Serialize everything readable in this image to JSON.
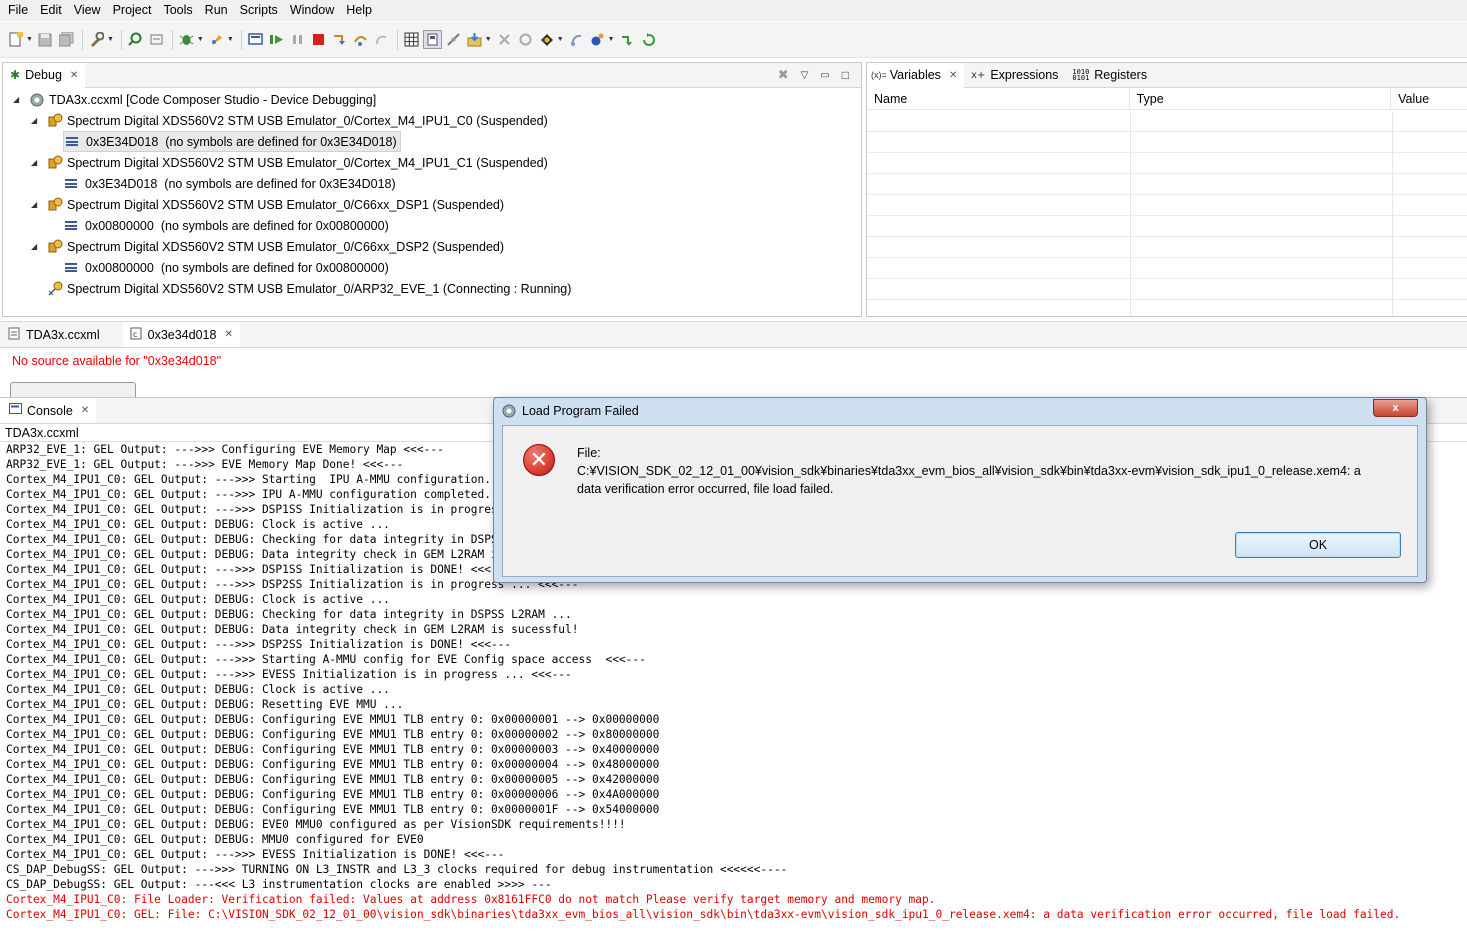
{
  "menu": [
    "File",
    "Edit",
    "View",
    "Project",
    "Tools",
    "Run",
    "Scripts",
    "Window",
    "Help"
  ],
  "toolbar_icons": [
    "new-icon",
    "save-icon",
    "save-all-icon",
    "build-icon",
    "search-icon",
    "refresh-icon",
    "debug-icon",
    "flash-icon",
    "console-icon",
    "resume-icon",
    "suspend-icon",
    "terminate-icon",
    "step-into-icon",
    "step-over-icon",
    "step-return-icon",
    "memory-icon",
    "toggle-icon",
    "connect-icon",
    "load-icon",
    "reset-icon",
    "restart-icon",
    "breakpoint-icon",
    "run-icon",
    "assembly-step-icon",
    "refresh-target-icon"
  ],
  "debug": {
    "tab_label": "Debug",
    "root": "TDA3x.ccxml [Code Composer Studio - Device Debugging]",
    "targets": [
      {
        "label": "Spectrum Digital XDS560V2 STM USB Emulator_0/Cortex_M4_IPU1_C0 (Suspended)",
        "frame_addr": "0x3E34D018",
        "frame_note": "(no symbols are defined for 0x3E34D018)"
      },
      {
        "label": "Spectrum Digital XDS560V2 STM USB Emulator_0/Cortex_M4_IPU1_C1 (Suspended)",
        "frame_addr": "0x3E34D018",
        "frame_note": "(no symbols are defined for 0x3E34D018)"
      },
      {
        "label": "Spectrum Digital XDS560V2 STM USB Emulator_0/C66xx_DSP1 (Suspended)",
        "frame_addr": "0x00800000",
        "frame_note": "(no symbols are defined for 0x00800000)"
      },
      {
        "label": "Spectrum Digital XDS560V2 STM USB Emulator_0/C66xx_DSP2 (Suspended)",
        "frame_addr": "0x00800000",
        "frame_note": "(no symbols are defined for 0x00800000)"
      },
      {
        "label": "Spectrum Digital XDS560V2 STM USB Emulator_0/ARP32_EVE_1 (Connecting : Running)"
      }
    ]
  },
  "variables": {
    "tabs": [
      {
        "icon": "(x)=",
        "label": "Variables"
      },
      {
        "icon": "expressions-icon",
        "label": "Expressions"
      },
      {
        "icon": "registers-icon",
        "label": "Registers"
      }
    ],
    "columns": [
      "Name",
      "Type",
      "Value"
    ]
  },
  "editor": {
    "tabs": [
      "TDA3x.ccxml",
      "0x3e34d018"
    ],
    "message": "No source available for \"0x3e34d018\""
  },
  "console": {
    "tab_label": "Console",
    "title": "TDA3x.ccxml",
    "lines": [
      {
        "text": "ARP32_EVE_1: GEL Output: --->>> Configuring EVE Memory Map <<<---"
      },
      {
        "text": "ARP32_EVE_1: GEL Output: --->>> EVE Memory Map Done! <<<---"
      },
      {
        "text": "Cortex_M4_IPU1_C0: GEL Output: --->>> Starting  IPU A-MMU configuration..."
      },
      {
        "text": "Cortex_M4_IPU1_C0: GEL Output: --->>> IPU A-MMU configuration completed..."
      },
      {
        "text": "Cortex_M4_IPU1_C0: GEL Output: --->>> DSP1SS Initialization is in progress ... <<<---"
      },
      {
        "text": "Cortex_M4_IPU1_C0: GEL Output: DEBUG: Clock is active ..."
      },
      {
        "text": "Cortex_M4_IPU1_C0: GEL Output: DEBUG: Checking for data integrity in DSPSS L2RAM ..."
      },
      {
        "text": "Cortex_M4_IPU1_C0: GEL Output: DEBUG: Data integrity check in GEM L2RAM is sucessful!"
      },
      {
        "text": "Cortex_M4_IPU1_C0: GEL Output: --->>> DSP1SS Initialization is DONE! <<<---"
      },
      {
        "text": "Cortex_M4_IPU1_C0: GEL Output: --->>> DSP2SS Initialization is in progress ... <<<---"
      },
      {
        "text": "Cortex_M4_IPU1_C0: GEL Output: DEBUG: Clock is active ..."
      },
      {
        "text": "Cortex_M4_IPU1_C0: GEL Output: DEBUG: Checking for data integrity in DSPSS L2RAM ..."
      },
      {
        "text": "Cortex_M4_IPU1_C0: GEL Output: DEBUG: Data integrity check in GEM L2RAM is sucessful!"
      },
      {
        "text": "Cortex_M4_IPU1_C0: GEL Output: --->>> DSP2SS Initialization is DONE! <<<---"
      },
      {
        "text": "Cortex_M4_IPU1_C0: GEL Output: --->>> Starting A-MMU config for EVE Config space access  <<<---"
      },
      {
        "text": "Cortex_M4_IPU1_C0: GEL Output: --->>> EVESS Initialization is in progress ... <<<---"
      },
      {
        "text": "Cortex_M4_IPU1_C0: GEL Output: DEBUG: Clock is active ..."
      },
      {
        "text": "Cortex_M4_IPU1_C0: GEL Output: DEBUG: Resetting EVE MMU ..."
      },
      {
        "text": "Cortex_M4_IPU1_C0: GEL Output: DEBUG: Configuring EVE MMU1 TLB entry 0: 0x00000001 --> 0x00000000"
      },
      {
        "text": "Cortex_M4_IPU1_C0: GEL Output: DEBUG: Configuring EVE MMU1 TLB entry 0: 0x00000002 --> 0x80000000"
      },
      {
        "text": "Cortex_M4_IPU1_C0: GEL Output: DEBUG: Configuring EVE MMU1 TLB entry 0: 0x00000003 --> 0x40000000"
      },
      {
        "text": "Cortex_M4_IPU1_C0: GEL Output: DEBUG: Configuring EVE MMU1 TLB entry 0: 0x00000004 --> 0x48000000"
      },
      {
        "text": "Cortex_M4_IPU1_C0: GEL Output: DEBUG: Configuring EVE MMU1 TLB entry 0: 0x00000005 --> 0x42000000"
      },
      {
        "text": "Cortex_M4_IPU1_C0: GEL Output: DEBUG: Configuring EVE MMU1 TLB entry 0: 0x00000006 --> 0x4A000000"
      },
      {
        "text": "Cortex_M4_IPU1_C0: GEL Output: DEBUG: Configuring EVE MMU1 TLB entry 0: 0x0000001F --> 0x54000000"
      },
      {
        "text": "Cortex_M4_IPU1_C0: GEL Output: DEBUG: EVE0 MMU0 configured as per VisionSDK requirements!!!!"
      },
      {
        "text": "Cortex_M4_IPU1_C0: GEL Output: DEBUG: MMU0 configured for EVE0"
      },
      {
        "text": "Cortex_M4_IPU1_C0: GEL Output: --->>> EVESS Initialization is DONE! <<<---"
      },
      {
        "text": "CS_DAP_DebugSS: GEL Output: --->>> TURNING ON L3_INSTR and L3_3 clocks required for debug instrumentation <<<<<<----"
      },
      {
        "text": "CS_DAP_DebugSS: GEL Output: ---<<< L3 instrumentation clocks are enabled >>>> ---"
      },
      {
        "text": "Cortex_M4_IPU1_C0: File Loader: Verification failed: Values at address 0x8161FFC0 do not match Please verify target memory and memory map.",
        "error": true
      },
      {
        "text": "Cortex_M4_IPU1_C0: GEL: File: C:\\VISION_SDK_02_12_01_00\\vision_sdk\\binaries\\tda3xx_evm_bios_all\\vision_sdk\\bin\\tda3xx-evm\\vision_sdk_ipu1_0_release.xem4: a data verification error occurred, file load failed.",
        "error": true
      }
    ]
  },
  "dialog": {
    "title": "Load Program Failed",
    "message_lines": [
      "File:",
      "C:¥VISION_SDK_02_12_01_00¥vision_sdk¥binaries¥tda3xx_evm_bios_all¥vision_sdk¥bin¥tda3xx-evm¥vision_sdk_ipu1_0_release.xem4: a",
      "data verification error occurred, file load failed."
    ],
    "ok_label": "OK",
    "close_label": "x"
  },
  "colors": {
    "error_text": "#e00000",
    "dialog_frame": "#cfe0f2",
    "selection": "#e8e8e8"
  }
}
